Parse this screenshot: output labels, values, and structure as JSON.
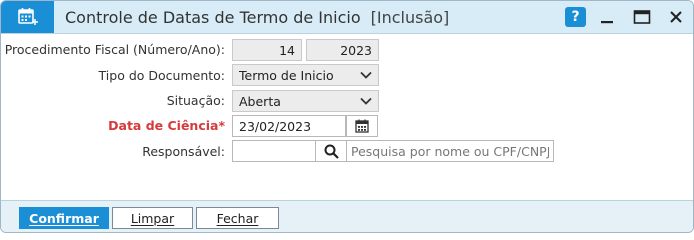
{
  "window": {
    "title": "Controle de Datas de Termo de Inicio",
    "mode": "[Inclusão]",
    "help_label": "?"
  },
  "form": {
    "procedimento": {
      "label": "Procedimento Fiscal (Número/Ano):",
      "numero": "14",
      "separator": "/",
      "ano": "2023"
    },
    "tipo_documento": {
      "label": "Tipo do Documento:",
      "value": "Termo de Inicio"
    },
    "situacao": {
      "label": "Situação:",
      "value": "Aberta"
    },
    "data_ciencia": {
      "label": "Data de Ciência*",
      "value": "23/02/2023"
    },
    "responsavel": {
      "label": "Responsável:",
      "code": "",
      "search_placeholder": "Pesquisa por nome ou CPF/CNPJ"
    }
  },
  "footer": {
    "confirm_label": "Confirmar",
    "clear_label": "Limpar",
    "close_label": "Fechar"
  },
  "colors": {
    "accent": "#1a8fd6",
    "titlebar_bg": "#d7ecf6",
    "required_label": "#d63a3a"
  },
  "icons": [
    "calendar-plus-icon",
    "help-icon",
    "minimize-icon",
    "maximize-icon",
    "close-icon",
    "chevron-down-icon",
    "calendar-icon",
    "search-icon"
  ]
}
